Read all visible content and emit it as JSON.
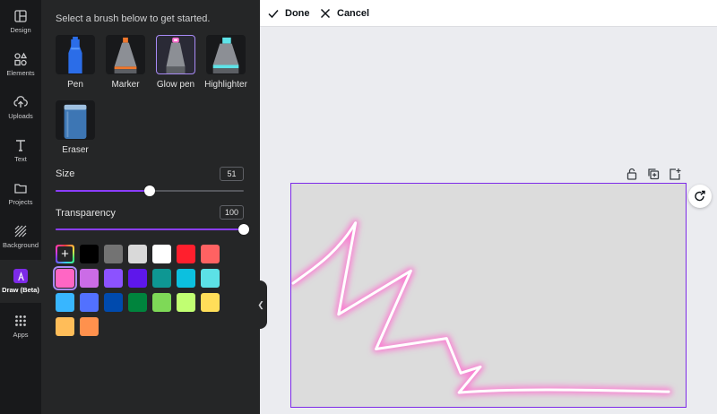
{
  "rail": {
    "items": [
      {
        "label": "Design",
        "icon": "design-icon"
      },
      {
        "label": "Elements",
        "icon": "elements-icon"
      },
      {
        "label": "Uploads",
        "icon": "upload-icon"
      },
      {
        "label": "Text",
        "icon": "text-icon"
      },
      {
        "label": "Projects",
        "icon": "folder-icon"
      },
      {
        "label": "Background",
        "icon": "background-icon"
      },
      {
        "label": "Draw (Beta)",
        "icon": "draw-icon",
        "active": true
      },
      {
        "label": "Apps",
        "icon": "apps-icon"
      }
    ]
  },
  "panel": {
    "intro": "Select a brush below to get started.",
    "brushes": [
      {
        "label": "Pen",
        "color": "#2b6de8"
      },
      {
        "label": "Marker",
        "color": "#f0772c"
      },
      {
        "label": "Glow pen",
        "color": "#ff6fd0",
        "selected": true
      },
      {
        "label": "Highlighter",
        "color": "#5ee3e8"
      },
      {
        "label": "Eraser",
        "color": "#3d76b4"
      }
    ],
    "size": {
      "label": "Size",
      "value": "51",
      "fraction": 0.5
    },
    "transparency": {
      "label": "Transparency",
      "value": "100",
      "fraction": 1.0
    },
    "add_color_label": "+",
    "swatch_rows": [
      [
        "add",
        "#000000",
        "#737373",
        "#d9d9d9",
        "#ffffff",
        "#ff1f2d",
        "#ff6262"
      ],
      [
        "#ff66c4",
        "#cb6ce6",
        "#8c52ff",
        "#5e17eb",
        "#0e9793",
        "#0cc0df",
        "#5ce1e6"
      ],
      [
        "#38b6ff",
        "#5271ff",
        "#004aad",
        "#00843d",
        "#7ed957",
        "#c1ff72",
        "#ffde59"
      ],
      [
        "#ffbd59",
        "#ff914d"
      ]
    ],
    "selected_swatch": "#ff66c4"
  },
  "topbar": {
    "done_label": "Done",
    "cancel_label": "Cancel"
  },
  "canvas": {
    "background": "#dcdcdc",
    "stroke_color": "#ffffff",
    "glow_color": "#ff6fd0"
  }
}
